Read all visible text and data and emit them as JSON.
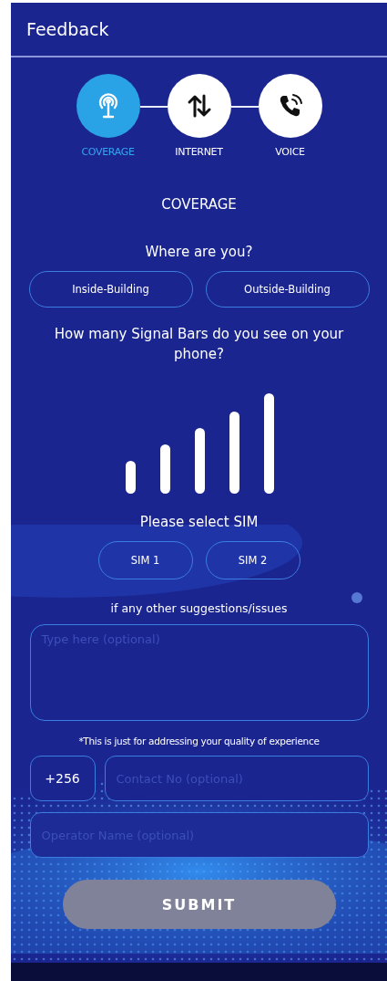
{
  "header": {
    "title": "Feedback"
  },
  "steps": [
    {
      "label": "COVERAGE",
      "kind": "coverage",
      "selected": true
    },
    {
      "label": "INTERNET",
      "kind": "internet",
      "selected": false
    },
    {
      "label": "VOICE",
      "kind": "voice",
      "selected": false
    }
  ],
  "section_title": "COVERAGE",
  "location": {
    "question": "Where are you?",
    "options": [
      {
        "label": "Inside-Building",
        "selected": false
      },
      {
        "label": "Outside-Building",
        "selected": false
      }
    ]
  },
  "signal": {
    "question": "How many Signal Bars do you see on your phone?"
  },
  "sim": {
    "question": "Please select SIM",
    "options": [
      {
        "label": "SIM 1",
        "selected": false
      },
      {
        "label": "SIM 2",
        "selected": false
      }
    ]
  },
  "suggestions": {
    "label": "if any other suggestions/issues",
    "placeholder": "Type here (optional)"
  },
  "note": "*This is just for addressing your quality of experience",
  "contact": {
    "country_code": "+256",
    "placeholder": "Contact No (optional)"
  },
  "operator": {
    "placeholder": "Operator Name (optional)"
  },
  "submit": {
    "label": "SUBMIT",
    "disabled": true
  }
}
